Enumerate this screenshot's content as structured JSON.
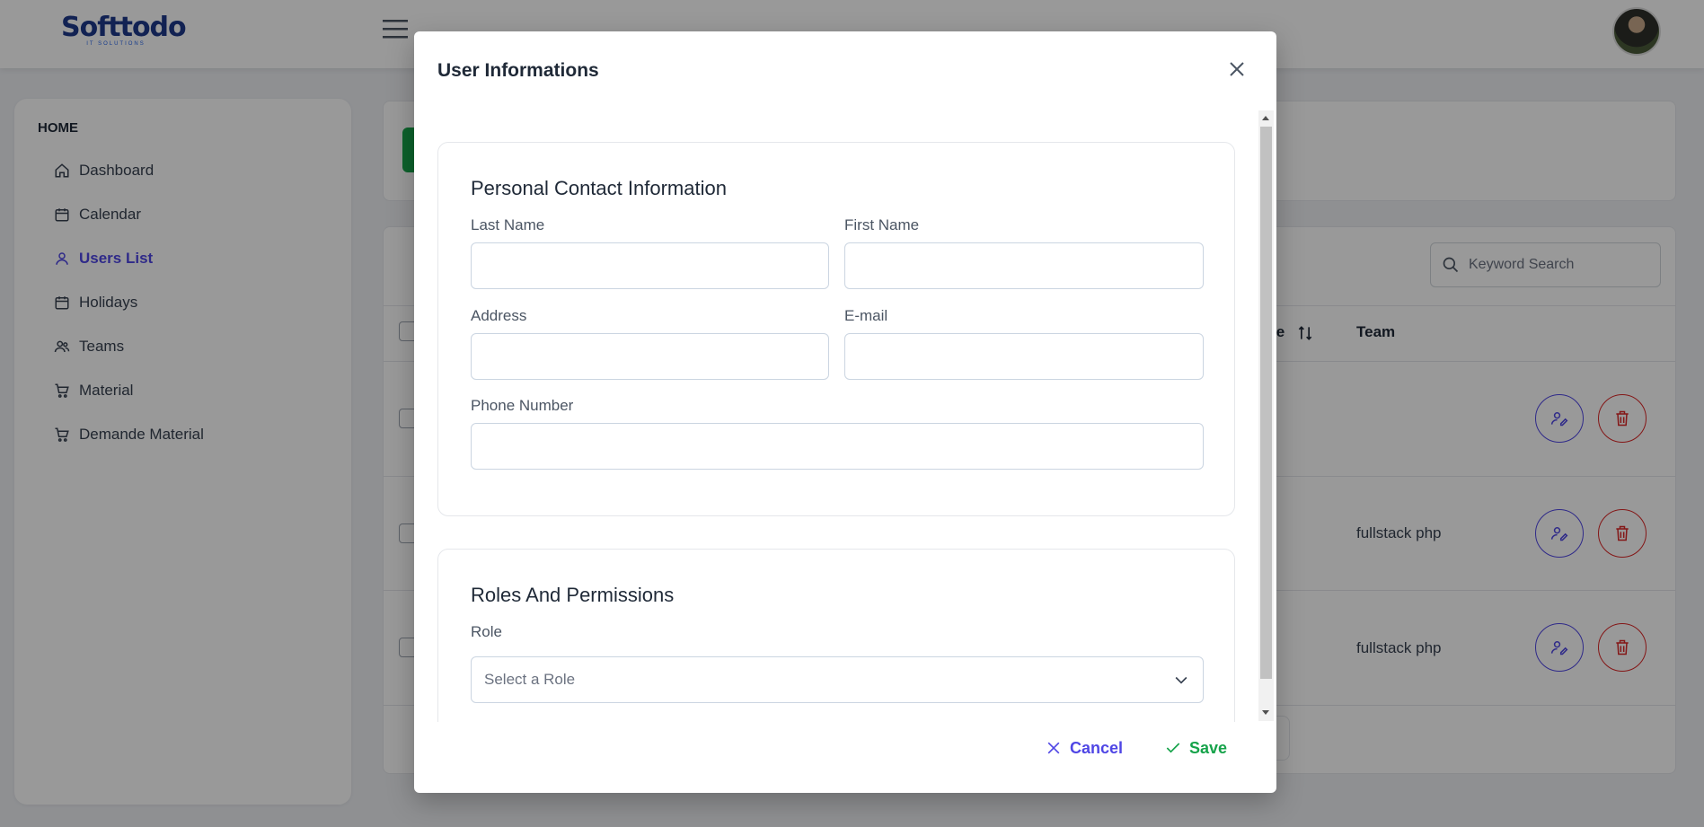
{
  "app": {
    "logo_text": "Softtodo",
    "logo_subtext": "IT SOLUTIONS"
  },
  "sidebar": {
    "heading": "HOME",
    "items": [
      {
        "label": "Dashboard",
        "icon": "home-icon"
      },
      {
        "label": "Calendar",
        "icon": "calendar-icon"
      },
      {
        "label": "Users List",
        "icon": "user-icon",
        "active": true
      },
      {
        "label": "Holidays",
        "icon": "calendar-icon"
      },
      {
        "label": "Teams",
        "icon": "users-icon"
      },
      {
        "label": "Material",
        "icon": "cart-icon"
      },
      {
        "label": "Demande Material",
        "icon": "cart-icon"
      }
    ]
  },
  "main": {
    "search_placeholder": "Keyword Search",
    "columns": {
      "phone_partial": "one",
      "team": "Team"
    },
    "rows": [
      {
        "team": ""
      },
      {
        "team": "fullstack php"
      },
      {
        "team": "fullstack php"
      }
    ]
  },
  "modal": {
    "title": "User Informations",
    "personal": {
      "title": "Personal Contact Information",
      "last_name_label": "Last Name",
      "last_name_value": "",
      "first_name_label": "First Name",
      "first_name_value": "",
      "address_label": "Address",
      "address_value": "",
      "email_label": "E-mail",
      "email_value": "",
      "phone_label": "Phone Number",
      "phone_value": ""
    },
    "roles": {
      "title": "Roles And Permissions",
      "role_label": "Role",
      "role_placeholder": "Select a Role"
    },
    "cancel_label": "Cancel",
    "save_label": "Save"
  },
  "colors": {
    "accent": "#4f46e5",
    "success": "#16a34a",
    "danger": "#dc2626"
  }
}
